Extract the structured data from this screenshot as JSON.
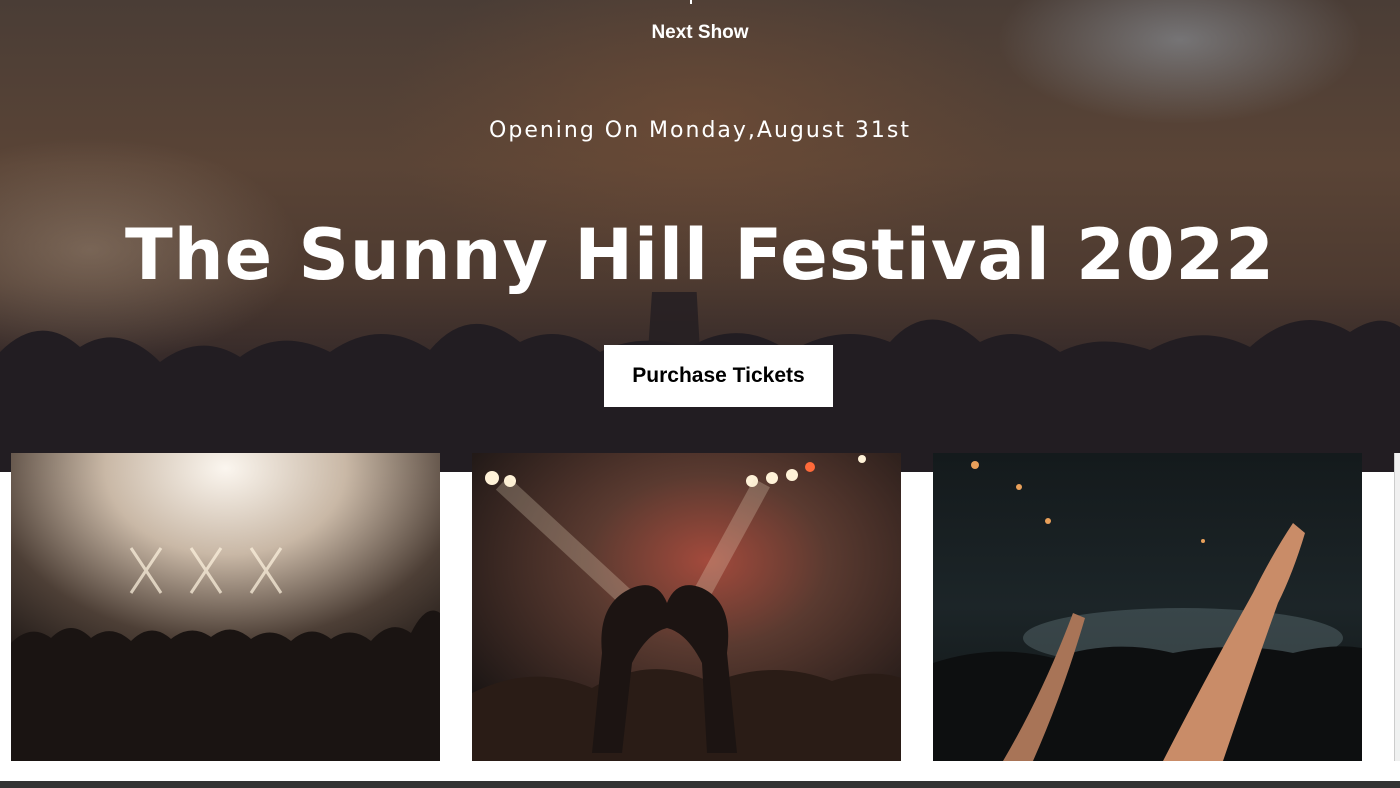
{
  "hero": {
    "next_show_label": "Next Show",
    "subtitle": "Opening On Monday,August 31st",
    "title": "The Sunny Hill Festival 2022",
    "cta_label": "Purchase Tickets"
  },
  "gallery": {
    "photos": [
      {
        "name": "concert-stage-lights-photo"
      },
      {
        "name": "heart-hands-crowd-photo"
      },
      {
        "name": "raised-hands-phones-photo"
      }
    ]
  },
  "colors": {
    "text_on_hero": "#ffffff",
    "button_bg": "#ffffff",
    "button_text": "#000000",
    "footer_bar": "#333333"
  }
}
